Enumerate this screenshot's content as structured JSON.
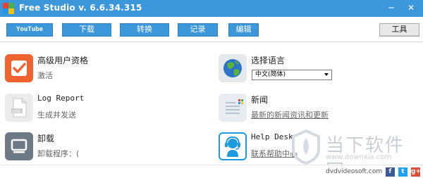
{
  "window": {
    "title": "Free Studio v. 6.6.34.315",
    "minimize_glyph": "─",
    "close_glyph": "✕",
    "titlebar_color": "#3c97da"
  },
  "toolbar": {
    "youtube_label": "YouTube",
    "download_label": "下载",
    "convert_label": "转换",
    "record_label": "记录",
    "edit_label": "编辑",
    "tools_label": "工具"
  },
  "items": {
    "premium": {
      "title": "高级用户资格",
      "subtitle": "激活",
      "icon": "checkmark-icon",
      "color": "#f0622f"
    },
    "language": {
      "title": "选择语言",
      "selected": "中文(简体)",
      "icon": "globe-icon"
    },
    "log_report": {
      "title": "Log Report",
      "subtitle": "生成并发送",
      "icon": "log-file-icon"
    },
    "news": {
      "title": "新闻",
      "subtitle": "最新的新闻资讯和更新",
      "icon": "news-icon"
    },
    "uninstall": {
      "title": "卸载",
      "subtitle": "卸载程序：(",
      "icon": "monitor-icon",
      "color": "#6d7a86"
    },
    "help_desk": {
      "title": "Help Desk",
      "subtitle": "联系帮助中心",
      "icon": "headset-icon",
      "color": "#1e9ae0"
    }
  },
  "watermark": {
    "text": "当下软件园",
    "url": "www.downxia.com"
  },
  "footer": {
    "site": "dvdvideosoft.com",
    "facebook": "f",
    "twitter": "t",
    "googleplus": "g+"
  }
}
